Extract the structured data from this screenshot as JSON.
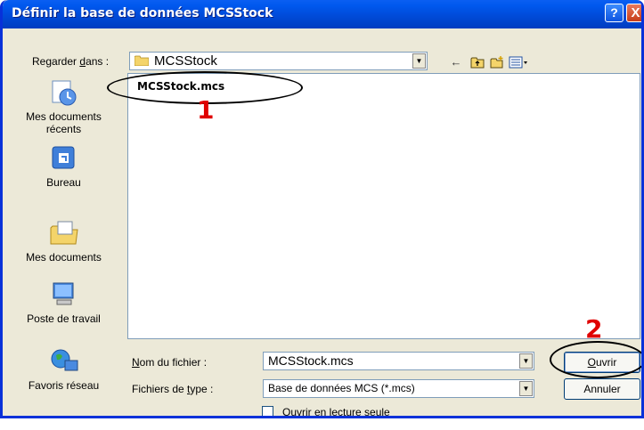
{
  "window": {
    "title": "Définir la base de données MCSStock",
    "help_label": "?",
    "close_label": "X"
  },
  "look_in": {
    "label_prefix": "Regarder ",
    "label_underlined": "d",
    "label_suffix": "ans :",
    "value": "MCSStock"
  },
  "places": [
    {
      "line1": "Mes documents",
      "line2": "récents",
      "icon": "recent-documents-icon"
    },
    {
      "line1": "Bureau",
      "line2": "",
      "icon": "desktop-icon"
    },
    {
      "line1": "Mes documents",
      "line2": "",
      "icon": "my-documents-icon"
    },
    {
      "line1": "Poste de travail",
      "line2": "",
      "icon": "my-computer-icon"
    },
    {
      "line1": "Favoris réseau",
      "line2": "",
      "icon": "network-places-icon"
    }
  ],
  "files": [
    {
      "name": "MCSStock.mcs"
    }
  ],
  "filename": {
    "label_underlined": "N",
    "label_rest": "om du fichier :",
    "value": "MCSStock.mcs"
  },
  "filetype": {
    "label_prefix": "Fichiers de ",
    "label_underlined": "t",
    "label_suffix": "ype :",
    "value": "Base de données MCS (*.mcs)"
  },
  "readonly": {
    "label_prefix": "Ouvrir en le",
    "label_underlined": "c",
    "label_suffix": "ture seule"
  },
  "buttons": {
    "open_underlined": "O",
    "open_rest": "uvrir",
    "cancel": "Annuler"
  },
  "annotations": {
    "step1": "1",
    "step2": "2",
    "color": "#e00000"
  }
}
